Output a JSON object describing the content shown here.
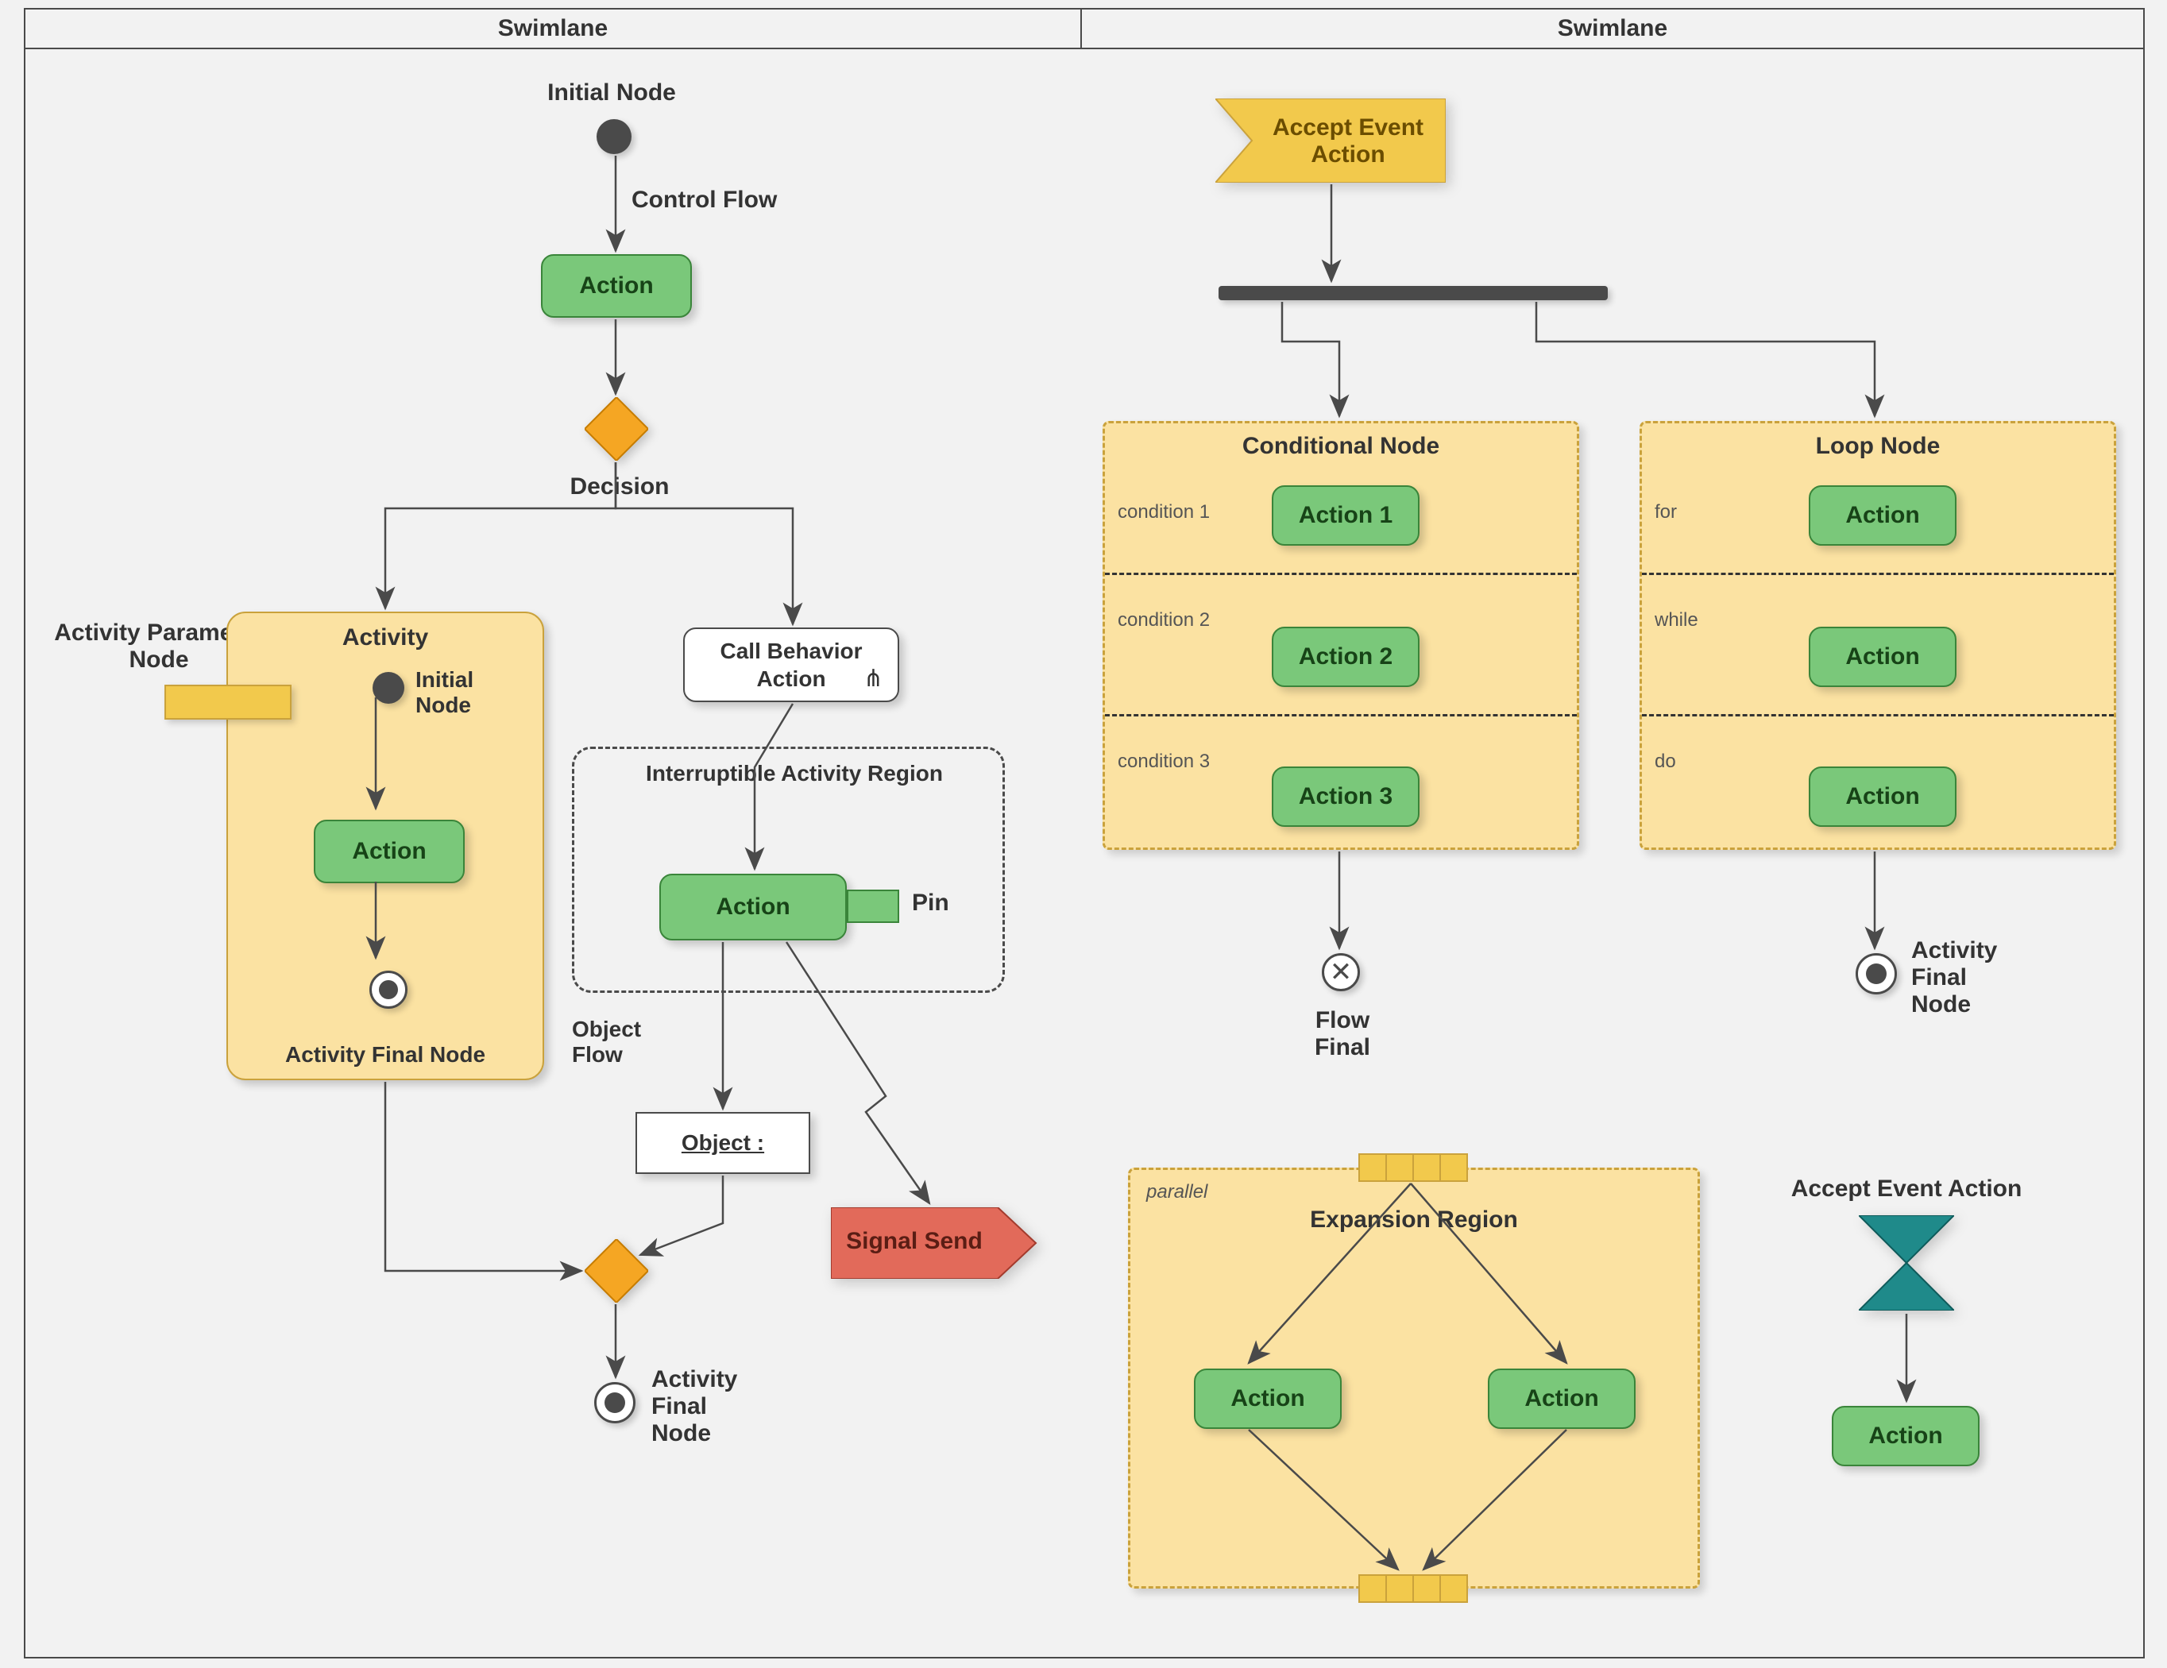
{
  "lanes": {
    "left": "Swimlane",
    "right": "Swimlane"
  },
  "left": {
    "initialNode": "Initial Node",
    "controlFlow": "Control Flow",
    "action1": "Action",
    "decision": "Decision",
    "activityParamNode": "Activity Parameter\nNode",
    "activityTitle": "Activity",
    "activityInitial": "Initial\nNode",
    "activityAction": "Action",
    "activityFinal": "Activity Final Node",
    "callBehavior": "Call Behavior\nAction",
    "interruptRegion": "Interruptible Activity Region",
    "regionAction": "Action",
    "pin": "Pin",
    "objectFlow": "Object\nFlow",
    "object": "Object :",
    "signalSend": "Signal Send",
    "mergeFinal": "Activity\nFinal\nNode"
  },
  "right": {
    "acceptEvent": "Accept Event\nAction",
    "conditionalTitle": "Conditional Node",
    "cond1": "condition 1",
    "cond1Action": "Action 1",
    "cond2": "condition 2",
    "cond2Action": "Action 2",
    "cond3": "condition 3",
    "cond3Action": "Action 3",
    "loopTitle": "Loop Node",
    "loopFor": "for",
    "loopForAction": "Action",
    "loopWhile": "while",
    "loopWhileAction": "Action",
    "loopDo": "do",
    "loopDoAction": "Action",
    "flowFinal": "Flow\nFinal",
    "activityFinal": "Activity\nFinal\nNode",
    "expansionTitle": "Expansion Region",
    "expansionMode": "parallel",
    "expA": "Action",
    "expB": "Action",
    "acceptTime": "Accept Event Action",
    "timeAction": "Action"
  }
}
